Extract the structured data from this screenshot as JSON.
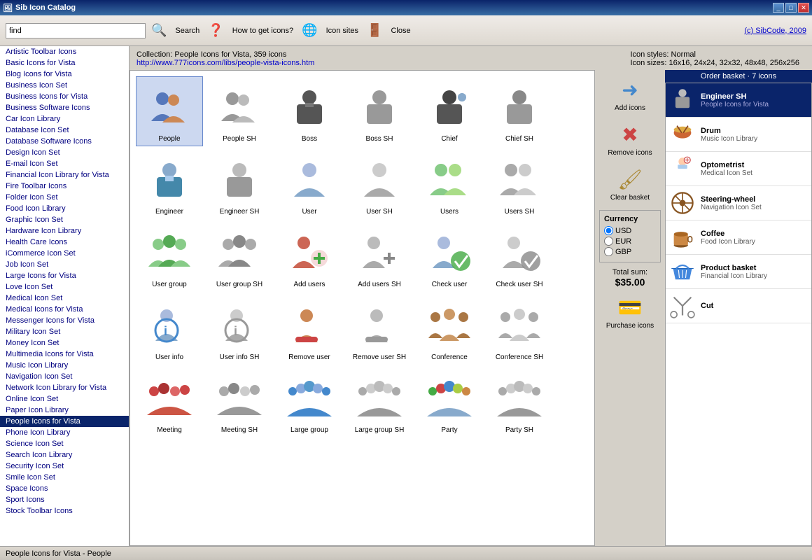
{
  "titleBar": {
    "title": "Sib Icon Catalog",
    "controls": [
      "minimize",
      "maximize",
      "close"
    ]
  },
  "toolbar": {
    "searchPlaceholder": "find",
    "searchValue": "find",
    "buttons": [
      {
        "id": "search",
        "label": "Search"
      },
      {
        "id": "howto",
        "label": "How to get icons?"
      },
      {
        "id": "sites",
        "label": "Icon sites"
      },
      {
        "id": "close",
        "label": "Close"
      }
    ],
    "sibcode": "(c) SibCode, 2009"
  },
  "sidebar": {
    "items": [
      "Artistic Toolbar Icons",
      "Basic Icons for Vista",
      "Blog Icons for Vista",
      "Business Icon Set",
      "Business Icons for Vista",
      "Business Software Icons",
      "Car Icon Library",
      "Database Icon Set",
      "Database Software Icons",
      "Design Icon Set",
      "E-mail Icon Set",
      "Financial Icon Library for Vista",
      "Fire Toolbar Icons",
      "Folder Icon Set",
      "Food Icon Library",
      "Graphic Icon Set",
      "Hardware Icon Library",
      "Health Care Icons",
      "iCommerce Icon Set",
      "Job Icon Set",
      "Large Icons for Vista",
      "Love Icon Set",
      "Medical Icon Set",
      "Medical Icons for Vista",
      "Messenger Icons for Vista",
      "Military Icon Set",
      "Money Icon Set",
      "Multimedia Icons for Vista",
      "Music Icon Library",
      "Navigation Icon Set",
      "Network Icon Library for Vista",
      "Online Icon Set",
      "Paper Icon Library",
      "People Icons for Vista",
      "Phone Icon Library",
      "Science Icon Set",
      "Search Icon Library",
      "Security Icon Set",
      "Smile Icon Set",
      "Space Icons",
      "Sport Icons",
      "Stock Toolbar Icons"
    ],
    "activeIndex": 33
  },
  "collection": {
    "title": "Collection: People Icons for Vista, 359 icons",
    "link": "http://www.777icons.com/libs/people-vista-icons.htm",
    "styles": "Icon styles:  Normal",
    "sizes": "Icon sizes:  16x16, 24x24, 32x32, 48x48, 256x256"
  },
  "icons": [
    {
      "id": "people",
      "label": "People",
      "selected": true,
      "color": "#4466aa"
    },
    {
      "id": "people-sh",
      "label": "People SH",
      "color": "#888"
    },
    {
      "id": "boss",
      "label": "Boss",
      "color": "#444"
    },
    {
      "id": "boss-sh",
      "label": "Boss SH",
      "color": "#888"
    },
    {
      "id": "chief",
      "label": "Chief",
      "color": "#444"
    },
    {
      "id": "chief-sh",
      "label": "Chief SH",
      "color": "#888"
    },
    {
      "id": "engineer",
      "label": "Engineer",
      "color": "#4488aa"
    },
    {
      "id": "engineer-sh",
      "label": "Engineer SH",
      "color": "#888"
    },
    {
      "id": "user",
      "label": "User",
      "color": "#88aacc"
    },
    {
      "id": "user-sh",
      "label": "User SH",
      "color": "#888"
    },
    {
      "id": "users",
      "label": "Users",
      "color": "#88cc88"
    },
    {
      "id": "users-sh",
      "label": "Users SH",
      "color": "#888"
    },
    {
      "id": "user-group",
      "label": "User group",
      "color": "#88cc88"
    },
    {
      "id": "user-group-sh",
      "label": "User group SH",
      "color": "#888"
    },
    {
      "id": "add-users",
      "label": "Add users",
      "color": "#cc4444"
    },
    {
      "id": "add-users-sh",
      "label": "Add users SH",
      "color": "#888"
    },
    {
      "id": "check-user",
      "label": "Check user",
      "color": "#44aa44"
    },
    {
      "id": "check-user-sh",
      "label": "Check user SH",
      "color": "#888"
    },
    {
      "id": "user-info",
      "label": "User info",
      "color": "#4488cc"
    },
    {
      "id": "user-info-sh",
      "label": "User info SH",
      "color": "#888"
    },
    {
      "id": "remove-user",
      "label": "Remove user",
      "color": "#cc4444"
    },
    {
      "id": "remove-user-sh",
      "label": "Remove user SH",
      "color": "#888"
    },
    {
      "id": "conference",
      "label": "Conference",
      "color": "#aa6633"
    },
    {
      "id": "conference-sh",
      "label": "Conference SH",
      "color": "#888"
    },
    {
      "id": "meeting",
      "label": "Meeting",
      "color": "#cc4444"
    },
    {
      "id": "meeting-sh",
      "label": "Meeting SH",
      "color": "#888"
    },
    {
      "id": "large-group",
      "label": "Large group",
      "color": "#4488cc"
    },
    {
      "id": "large-group-sh",
      "label": "Large group SH",
      "color": "#888"
    },
    {
      "id": "party",
      "label": "Party",
      "color": "#44aa44"
    },
    {
      "id": "party-sh",
      "label": "Party SH",
      "color": "#888"
    }
  ],
  "actions": {
    "addLabel": "Add icons",
    "removeLabel": "Remove icons",
    "clearLabel": "Clear basket",
    "purchaseLabel": "Purchase icons",
    "currency": {
      "title": "Currency",
      "options": [
        "USD",
        "EUR",
        "GBP"
      ],
      "selected": "USD"
    },
    "totalLabel": "Total sum:",
    "totalAmount": "$35.00"
  },
  "basket": {
    "title": "Order basket · 7 icons",
    "items": [
      {
        "id": "engineer-sh-b",
        "name": "Engineer SH",
        "sub": "People Icons for Vista",
        "selected": true
      },
      {
        "id": "drum-b",
        "name": "Drum",
        "sub": "Music Icon Library",
        "selected": false
      },
      {
        "id": "optometrist-b",
        "name": "Optometrist",
        "sub": "Medical Icon Set",
        "selected": false
      },
      {
        "id": "steering-b",
        "name": "Steering-wheel",
        "sub": "Navigation Icon Set",
        "selected": false
      },
      {
        "id": "coffee-b",
        "name": "Coffee",
        "sub": "Food Icon Library",
        "selected": false
      },
      {
        "id": "product-basket-b",
        "name": "Product basket",
        "sub": "Financial Icon Library",
        "selected": false
      },
      {
        "id": "cut-b",
        "name": "Cut",
        "sub": "",
        "selected": false
      }
    ]
  },
  "statusBar": {
    "text": "People Icons for Vista - People"
  }
}
